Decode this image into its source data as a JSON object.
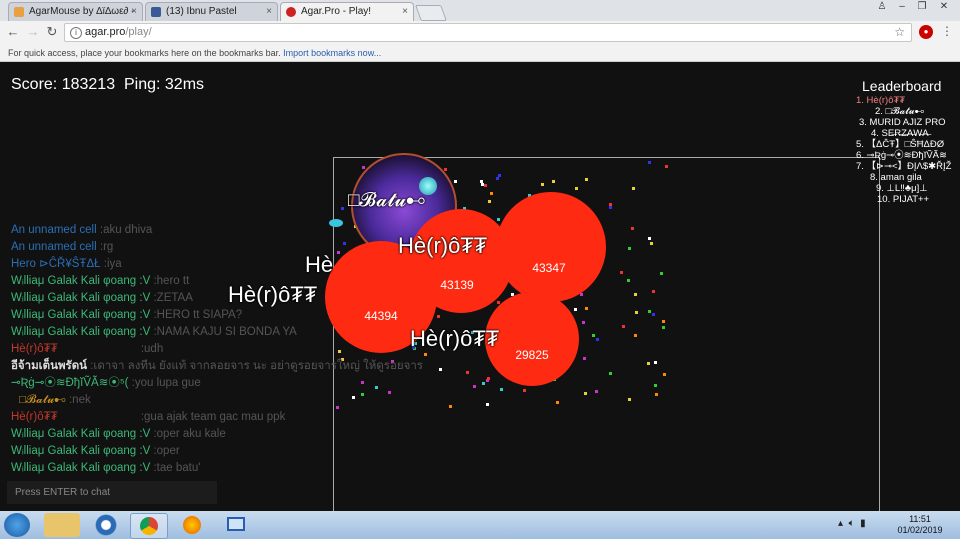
{
  "browser": {
    "tabs": [
      {
        "title": "AgarMouse by ∆ï∆ωε∂ -",
        "color": "#e8a040"
      },
      {
        "title": "(13) Ibnu Pastel",
        "color": "#3b5998"
      },
      {
        "title": "Agar.Pro - Play!",
        "color": "#cc2222"
      }
    ],
    "close_glyph": "×",
    "url_host": "agar.pro",
    "url_path": "/play/",
    "bookmarks_hint": "For quick access, place your bookmarks here on the bookmarks bar.",
    "bookmarks_link": "Import bookmarks now..."
  },
  "hud": {
    "score_label": "Score:",
    "score": "183213",
    "ping_label": "Ping:",
    "ping": "32ms"
  },
  "leaderboard": {
    "title": "Leaderboard",
    "entries": [
      "1. Hè(r)ô₮₮",
      "2. □𝓑𝓪𝓽𝓾⊷",
      "3. MURID AJIZ PRO",
      "4. SE̶R̶Z̶A̶W̶A̶",
      "5. 【ΔĈŦ】□ŜĦΔĐØ",
      "6. ⊸Ʀġ⊸⦿≋ĐђĭṼÃ≋",
      "7. 【⊳⊸<】ÐĮΛ$✱ŘĮŽ",
      "8. aman      gila",
      "9. ⊥L‼♣μ]⊥",
      "10. PIJAT++"
    ]
  },
  "cells": [
    {
      "mass": "44394",
      "name": "Hè(r)ô₮₮"
    },
    {
      "mass": "43139",
      "name": "Hè(r)ô₮₮"
    },
    {
      "mass": "43347",
      "name": ""
    },
    {
      "mass": "29825",
      "name": "Hè(r)ô₮₮"
    }
  ],
  "skin_cell_name": "□𝓑𝓪𝓽𝓾⊷",
  "partial_name": "Hè",
  "chat": [
    {
      "name": "An unnamed cell",
      "msg": ":aku dhiva",
      "color": "#2a6fb5"
    },
    {
      "name": "An unnamed cell",
      "msg": ":rg",
      "color": "#2a6fb5"
    },
    {
      "name": "Hero ⊳ĈŘ¥ŜŦΔŁ",
      "msg": ":iya",
      "color": "#2a6fb5"
    },
    {
      "name": "Wᵢlliaμ Galak Kali φoang :V",
      "msg": ":hero tt",
      "color": "#3cb878"
    },
    {
      "name": "Wᵢlliaμ Galak Kali φoang :V",
      "msg": ":ZETAA",
      "color": "#3cb878"
    },
    {
      "name": "Wᵢlliaμ Galak Kali φoang :V",
      "msg": ":HERO tt SIAPA?",
      "color": "#3cb878"
    },
    {
      "name": "Wᵢlliaμ Galak Kali φoang :V",
      "msg": ":NAMA KAJU SI BONDA YA",
      "color": "#3cb878"
    },
    {
      "name": "Hè(r)ô₮₮",
      "msg": ":udh",
      "color": "#c0392b"
    },
    {
      "name": "อีจ้ามเต็นพรัดน์",
      "msg": ":เดาจา ลงทีน ยังแท้ จากลอยจาร นะ อย่าดูรอยจารใหญ่ ให้ดูรอยจาร",
      "color": "#dddddd"
    },
    {
      "name": "⊸Ʀġ⊸⦿≋ĐђĭṼÃ≋⦿⁵(",
      "msg": ":you lupa gue",
      "color": "#3cb878"
    },
    {
      "name": "□𝓑𝓪𝓽𝓾⊷",
      "msg": ":nek",
      "color": "#c89020"
    },
    {
      "name": "Hè(r)ô₮₮",
      "msg": ":gua ajak team gac mau ppk",
      "color": "#c0392b"
    },
    {
      "name": "Wᵢlliaμ Galak Kali φoang :V",
      "msg": ":oper aku kale",
      "color": "#3cb878"
    },
    {
      "name": "Wᵢlliaμ Galak Kali φoang :V",
      "msg": ":oper",
      "color": "#3cb878"
    },
    {
      "name": "Wᵢlliaμ Galak Kali φoang :V",
      "msg": ":tae batu'",
      "color": "#3cb878"
    }
  ],
  "chat_placeholder": "Press ENTER to chat",
  "taskbar": {
    "time": "11:51",
    "date": "01/02/2019"
  },
  "colors": {
    "cell": "#ff2a12",
    "leader_self": "#f08080",
    "background": "#111111"
  }
}
